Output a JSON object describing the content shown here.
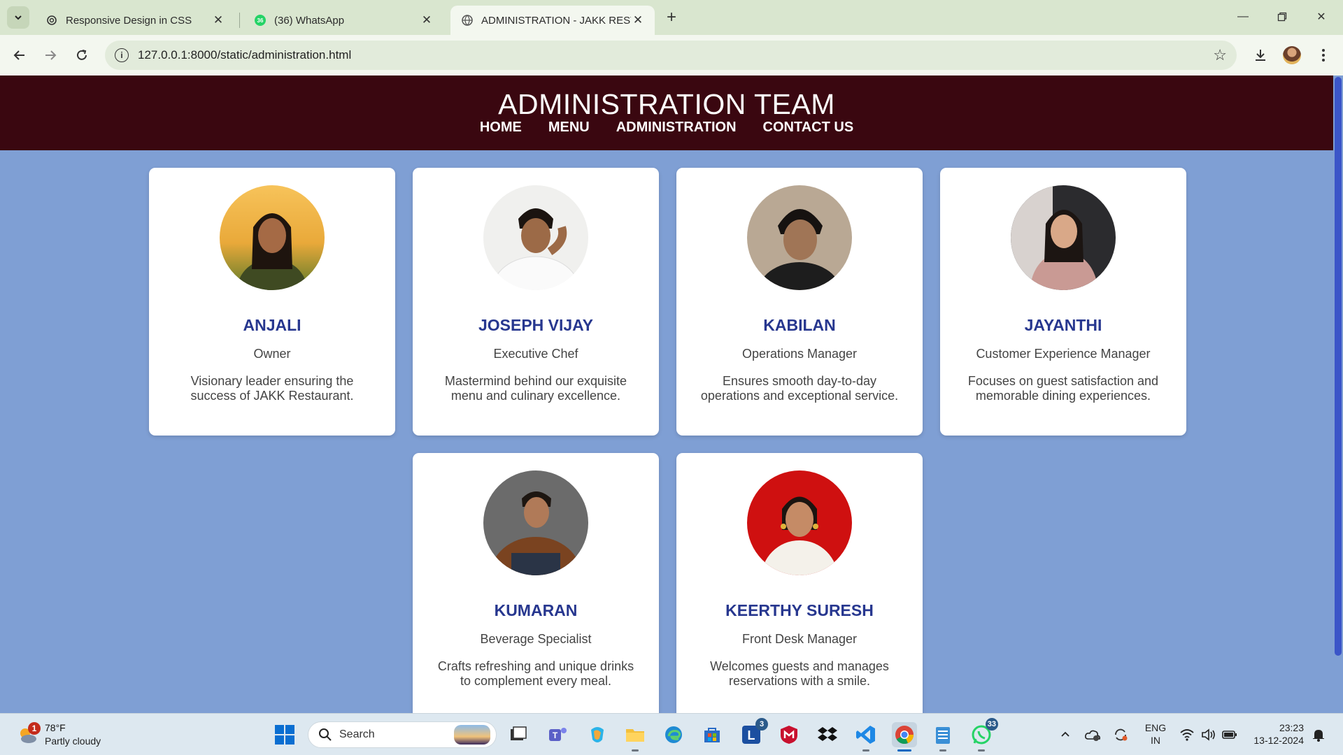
{
  "browser": {
    "tabs": [
      {
        "title": "Responsive Design in CSS",
        "favicon": "openai-icon"
      },
      {
        "title": "(36) WhatsApp",
        "favicon": "whatsapp-icon",
        "badge": "36"
      },
      {
        "title": "ADMINISTRATION - JAKK RESTA",
        "favicon": "globe-icon",
        "active": true
      }
    ],
    "url": "127.0.0.1:8000/static/administration.html"
  },
  "page": {
    "title": "ADMINISTRATION TEAM",
    "nav": [
      "HOME",
      "MENU",
      "ADMINISTRATION",
      "CONTACT US"
    ],
    "team": [
      {
        "name": "ANJALI",
        "role": "Owner",
        "description": "Visionary leader ensuring the success of JAKK Restaurant."
      },
      {
        "name": "JOSEPH VIJAY",
        "role": "Executive Chef",
        "description": "Mastermind behind our exquisite menu and culinary excellence."
      },
      {
        "name": "KABILAN",
        "role": "Operations Manager",
        "description": "Ensures smooth day-to-day operations and exceptional service."
      },
      {
        "name": "JAYANTHI",
        "role": "Customer Experience Manager",
        "description": "Focuses on guest satisfaction and memorable dining experiences."
      },
      {
        "name": "KUMARAN",
        "role": "Beverage Specialist",
        "description": "Crafts refreshing and unique drinks to complement every meal."
      },
      {
        "name": "KEERTHY SURESH",
        "role": "Front Desk Manager",
        "description": "Welcomes guests and manages reservations with a smile."
      }
    ],
    "colors": {
      "header_bg": "#3a0710",
      "page_bg": "#7f9fd4",
      "name_color": "#27378f"
    }
  },
  "taskbar": {
    "weather": {
      "temp": "78°F",
      "condition": "Partly cloudy",
      "badge": "1"
    },
    "search_label": "Search",
    "badges": {
      "l_app": "3",
      "whatsapp": "33"
    },
    "language": {
      "line1": "ENG",
      "line2": "IN"
    },
    "time": "23:23",
    "date": "13-12-2024"
  }
}
